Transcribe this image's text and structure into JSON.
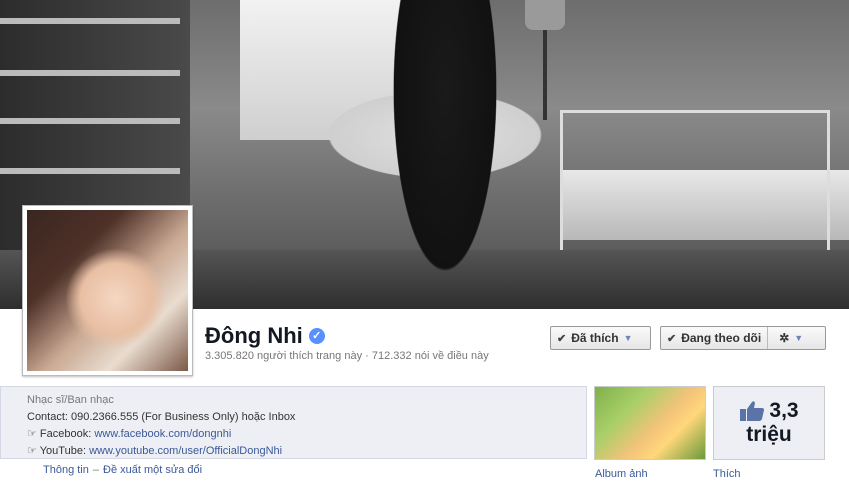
{
  "page": {
    "name": "Đông Nhi",
    "verified_icon": "verified-check-icon",
    "likes_count": "3.305.820",
    "likes_suffix": "người thích trang này",
    "separator": "·",
    "talking_count": "712.332",
    "talking_suffix": "nói về điều này"
  },
  "buttons": {
    "liked_label": "Đã thích",
    "following_label": "Đang theo dõi",
    "check_icon": "checkmark-icon",
    "caret_icon": "caret-down-icon",
    "gear_icon": "gear-icon"
  },
  "about": {
    "category": "Nhạc sĩ/Ban nhạc",
    "contact": "Contact: 090.2366.555 (For Business Only) hoặc Inbox",
    "facebook_prefix": "☞ Facebook:",
    "facebook_url": "www.facebook.com/dongnhi",
    "youtube_prefix": "☞ YouTube:",
    "youtube_url": "www.youtube.com/user/OfficialDongNhi",
    "info_link": "Thông tin",
    "dash": "–",
    "suggest_link": "Đề xuất một sửa đổi"
  },
  "tiles": {
    "album_label": "Album ảnh",
    "likes_number": "3,3",
    "likes_unit": "triệu",
    "likes_label": "Thích",
    "thumbs_icon": "thumbs-up-icon"
  },
  "colors": {
    "link": "#3b5998",
    "accent": "#5890ff",
    "panel_bg": "#edeff4"
  }
}
